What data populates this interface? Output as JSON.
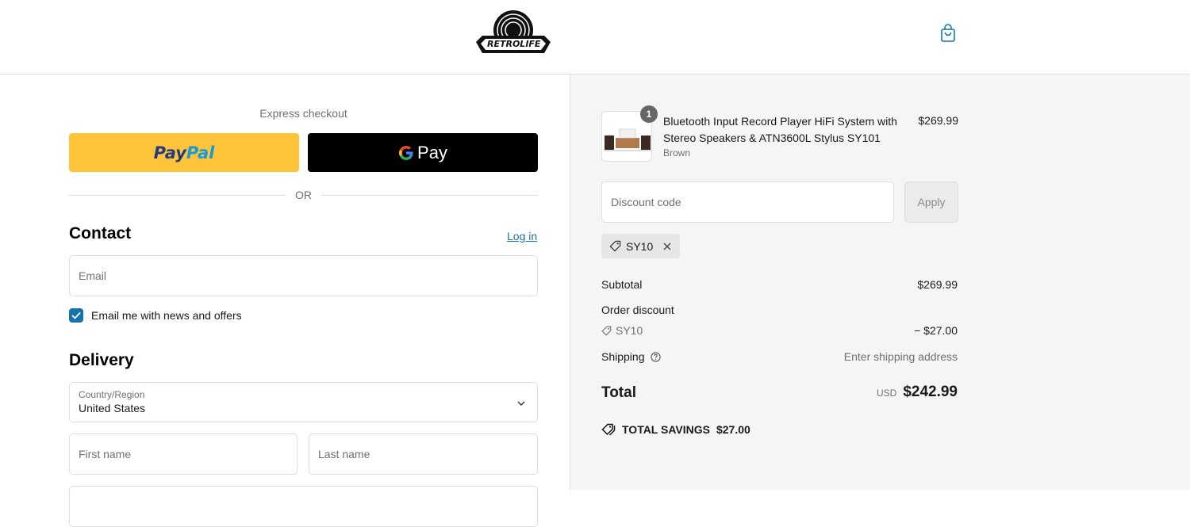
{
  "header": {
    "logo_text": "RETROLIFE",
    "cart_icon": "shopping-bag-icon"
  },
  "express": {
    "label": "Express checkout",
    "paypal_part1": "Pay",
    "paypal_part2": "Pal",
    "gpay_label": "Pay",
    "or_label": "OR"
  },
  "contact": {
    "heading": "Contact",
    "login_link": "Log in",
    "email_placeholder": "Email",
    "newsletter_label": "Email me with news and offers",
    "newsletter_checked": true
  },
  "delivery": {
    "heading": "Delivery",
    "country_label": "Country/Region",
    "country_value": "United States",
    "first_name_placeholder": "First name",
    "last_name_placeholder": "Last name"
  },
  "order": {
    "item": {
      "quantity": "1",
      "title": "Bluetooth Input Record Player HiFi System with Stereo Speakers & ATN3600L Stylus SY101",
      "variant": "Brown",
      "price": "$269.99"
    },
    "discount_placeholder": "Discount code",
    "apply_label": "Apply",
    "applied_code": "SY10",
    "subtotal_label": "Subtotal",
    "subtotal_value": "$269.99",
    "order_discount_label": "Order discount",
    "order_discount_code": "SY10",
    "order_discount_value": "− $27.00",
    "shipping_label": "Shipping",
    "shipping_value": "Enter shipping address",
    "total_label": "Total",
    "total_currency": "USD",
    "total_value": "$242.99",
    "savings_label": "TOTAL SAVINGS",
    "savings_value": "$27.00"
  },
  "colors": {
    "paypal_yellow": "#ffc439",
    "link_blue": "#1773b0",
    "summary_bg": "#f5f5f5"
  }
}
